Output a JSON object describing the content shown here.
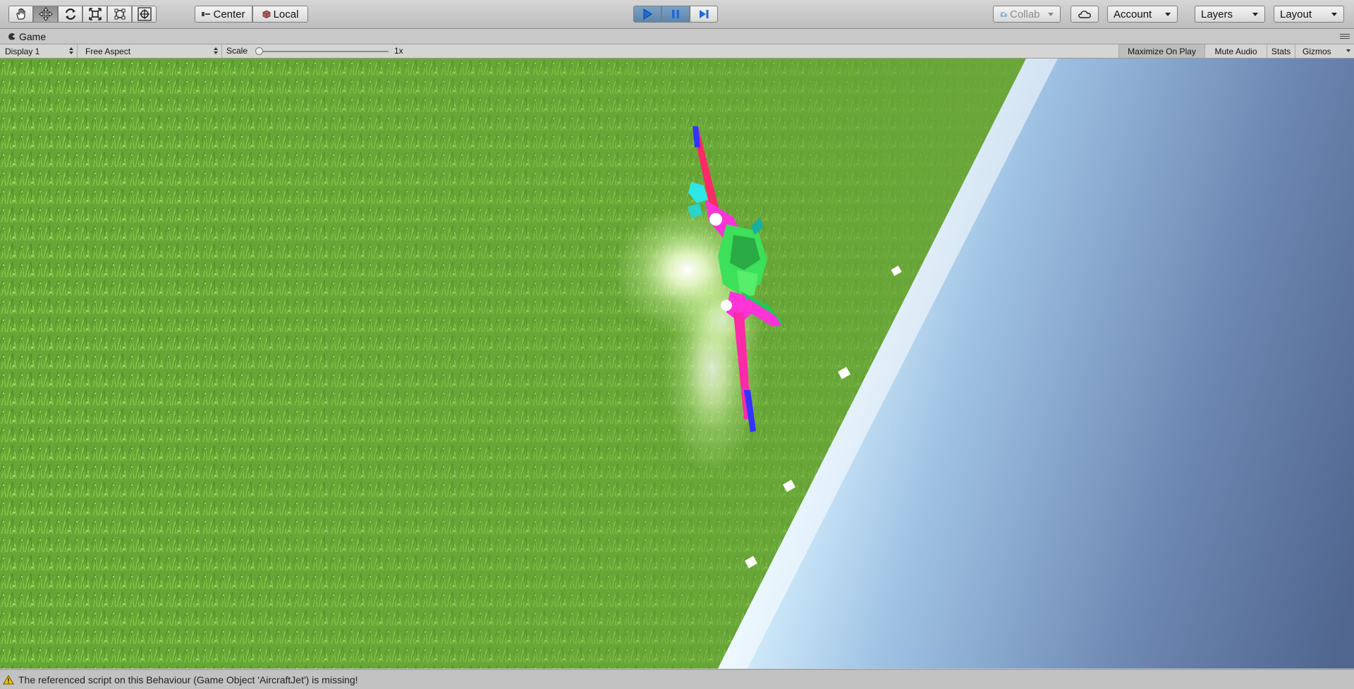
{
  "toolbar": {
    "tools": [
      {
        "name": "hand-tool",
        "icon": "hand-icon"
      },
      {
        "name": "move-tool",
        "icon": "move-arrows-icon"
      },
      {
        "name": "rotate-tool",
        "icon": "rotate-icon"
      },
      {
        "name": "scale-tool",
        "icon": "scale-icon"
      },
      {
        "name": "rect-tool",
        "icon": "rect-transform-icon"
      },
      {
        "name": "transform-tool",
        "icon": "transform-icon"
      }
    ],
    "active_tool": "move-tool",
    "pivot_label": "Center",
    "space_label": "Local",
    "playback": {
      "play_active": true,
      "pause_active": true
    },
    "collab_label": "Collab",
    "account_label": "Account",
    "layers_label": "Layers",
    "layout_label": "Layout"
  },
  "tab": {
    "title": "Game",
    "icon": "game-view-icon"
  },
  "game_bar": {
    "display": "Display 1",
    "aspect": "Free Aspect",
    "scale_label": "Scale",
    "scale_value": "1x",
    "maximize_label": "Maximize On Play",
    "mute_label": "Mute Audio",
    "stats_label": "Stats",
    "gizmos_label": "Gizmos"
  },
  "status": {
    "message": "The referenced script on this Behaviour (Game Object 'AircraftJet') is missing!",
    "icon": "warning-icon"
  },
  "colors": {
    "grass": "#6aa63a",
    "sky_light": "#e8f6ff",
    "sky_dark": "#536b93",
    "aircraft_magenta": "#ff30d8",
    "aircraft_green": "#35e65a",
    "accent_blue": "#2e6fd6"
  }
}
